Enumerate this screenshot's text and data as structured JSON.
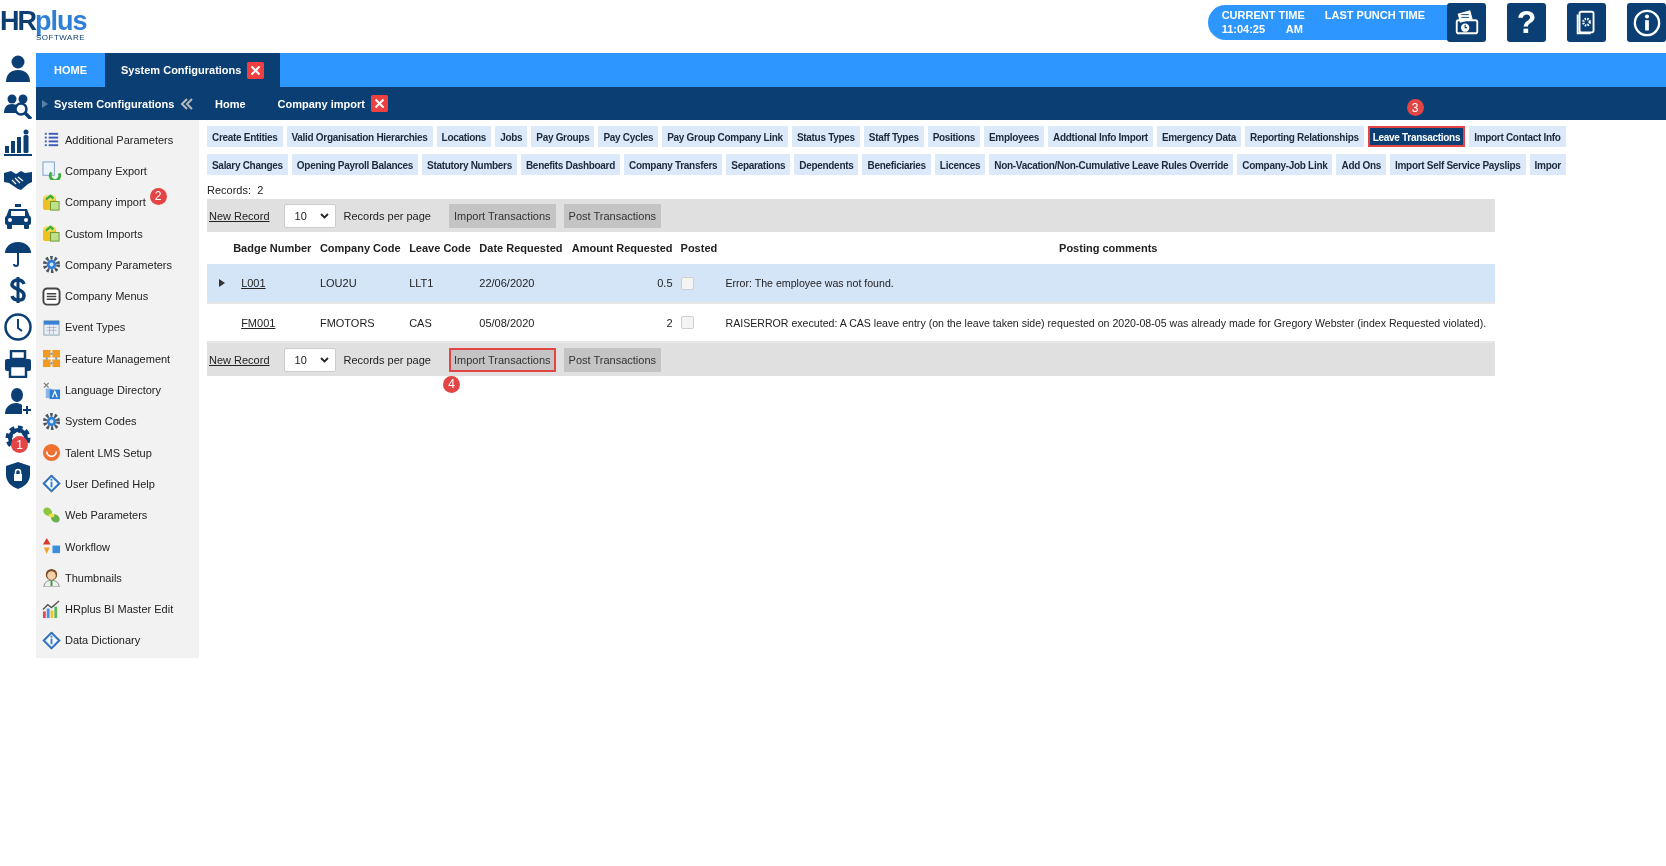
{
  "logo": {
    "brand_1": "HR",
    "brand_2": "plus",
    "tagline": "SOFTWARE"
  },
  "clock": {
    "current_label": "CURRENT TIME",
    "punch_label": "LAST PUNCH TIME",
    "current_value": "11:04:25 AM"
  },
  "header_buttons": [
    {
      "kind": "punch"
    },
    {
      "kind": "help",
      "glyph": "?"
    },
    {
      "kind": "settings"
    },
    {
      "kind": "info"
    }
  ],
  "rail": [
    {
      "kind": "user"
    },
    {
      "kind": "people"
    },
    {
      "kind": "chart"
    },
    {
      "kind": "handshake"
    },
    {
      "kind": "car"
    },
    {
      "kind": "umbrella"
    },
    {
      "kind": "dollar"
    },
    {
      "kind": "clock"
    },
    {
      "kind": "printer"
    },
    {
      "kind": "adduser"
    },
    {
      "kind": "gear",
      "badge": "1"
    },
    {
      "kind": "shield"
    }
  ],
  "top_tabs": [
    {
      "label": "HOME",
      "selected": false,
      "closable": false
    },
    {
      "label": "System Configurations",
      "selected": true,
      "closable": true
    }
  ],
  "section": {
    "title": "System Configurations"
  },
  "sub_tabs": [
    {
      "label": "Home",
      "closable": false
    },
    {
      "label": "Company import",
      "closable": true
    }
  ],
  "sidebar": [
    {
      "label": "Additional Parameters",
      "kind": "list"
    },
    {
      "label": "Company Export",
      "kind": "export"
    },
    {
      "label": "Company import",
      "kind": "import",
      "badge": "2"
    },
    {
      "label": "Custom Imports",
      "kind": "import"
    },
    {
      "label": "Company Parameters",
      "kind": "cog"
    },
    {
      "label": "Company Menus",
      "kind": "menu"
    },
    {
      "label": "Event Types",
      "kind": "calendar"
    },
    {
      "label": "Feature Management",
      "kind": "feature"
    },
    {
      "label": "Language Directory",
      "kind": "language"
    },
    {
      "label": "System Codes",
      "kind": "cog"
    },
    {
      "label": "Talent LMS Setup",
      "kind": "smile"
    },
    {
      "label": "User Defined Help",
      "kind": "diamond"
    },
    {
      "label": "Web Parameters",
      "kind": "web"
    },
    {
      "label": "Workflow",
      "kind": "workflow"
    },
    {
      "label": "Thumbnails",
      "kind": "person"
    },
    {
      "label": "HRplus BI Master Edit",
      "kind": "bi"
    },
    {
      "label": "Data Dictionary",
      "kind": "diamond"
    }
  ],
  "chip_rows": [
    [
      {
        "label": "Create Entities",
        "selected": false
      },
      {
        "label": "Valid Organisation Hierarchies",
        "selected": false
      },
      {
        "label": "Locations",
        "selected": false
      },
      {
        "label": "Jobs",
        "selected": false
      },
      {
        "label": "Pay Groups",
        "selected": false
      },
      {
        "label": "Pay Cycles",
        "selected": false
      },
      {
        "label": "Pay Group Company Link",
        "selected": false
      },
      {
        "label": "Status Types",
        "selected": false
      },
      {
        "label": "Staff Types",
        "selected": false
      },
      {
        "label": "Positions",
        "selected": false
      },
      {
        "label": "Employees",
        "selected": false
      },
      {
        "label": "Addtional Info Import",
        "selected": false
      },
      {
        "label": "Emergency Data",
        "selected": false
      },
      {
        "label": "Reporting Relationships",
        "selected": false
      },
      {
        "label": "Leave Transactions",
        "selected": true,
        "outlined": true,
        "badge": "3"
      },
      {
        "label": "Import Contact Info",
        "selected": false
      }
    ],
    [
      {
        "label": "Salary Changes",
        "selected": false
      },
      {
        "label": "Opening Payroll Balances",
        "selected": false
      },
      {
        "label": "Statutory Numbers",
        "selected": false
      },
      {
        "label": "Benefits Dashboard",
        "selected": false
      },
      {
        "label": "Company Transfers",
        "selected": false
      },
      {
        "label": "Separations",
        "selected": false
      },
      {
        "label": "Dependents",
        "selected": false
      },
      {
        "label": "Beneficiaries",
        "selected": false
      },
      {
        "label": "Licences",
        "selected": false
      },
      {
        "label": "Non-Vacation/Non-Cumulative Leave Rules Override",
        "selected": false
      },
      {
        "label": "Company-Job Link",
        "selected": false
      },
      {
        "label": "Add Ons",
        "selected": false
      },
      {
        "label": "Import Self Service Payslips",
        "selected": false
      },
      {
        "label": "Impor",
        "selected": false
      }
    ]
  ],
  "records": "Records:  2",
  "toolbars": [
    {
      "new_record": "New Record",
      "page_size": "10",
      "page_size_label": "Records per page",
      "buttons": [
        {
          "label": "Import Transactions"
        },
        {
          "label": "Post Transactions"
        }
      ]
    },
    {
      "new_record": "New Record",
      "page_size": "10",
      "page_size_label": "Records per page",
      "buttons": [
        {
          "label": "Import Transactions",
          "outlined": true,
          "badge": "4"
        },
        {
          "label": "Post Transactions"
        }
      ]
    }
  ],
  "table": {
    "columns": [
      "Badge Number",
      "Company Code",
      "Leave Code",
      "Date Requested",
      "Amount Requested",
      "Posted",
      "Posting comments"
    ],
    "rows": [
      {
        "selected": true,
        "expandable": true,
        "badge_number": "L001",
        "company_code": "LOU2U",
        "leave_code": "LLT1",
        "date_requested": "22/06/2020",
        "amount_requested": "0.5",
        "posted": false,
        "comment": "Error: The employee was not found."
      },
      {
        "selected": false,
        "expandable": false,
        "badge_number": "FM001",
        "company_code": "FMOTORS",
        "leave_code": "CAS",
        "date_requested": "05/08/2020",
        "amount_requested": "2",
        "posted": false,
        "comment": "RAISERROR executed: A CAS leave entry (on the leave taken side) requested on 2020-08-05 was already made for Gregory Webster (index Requested violated)."
      }
    ]
  }
}
